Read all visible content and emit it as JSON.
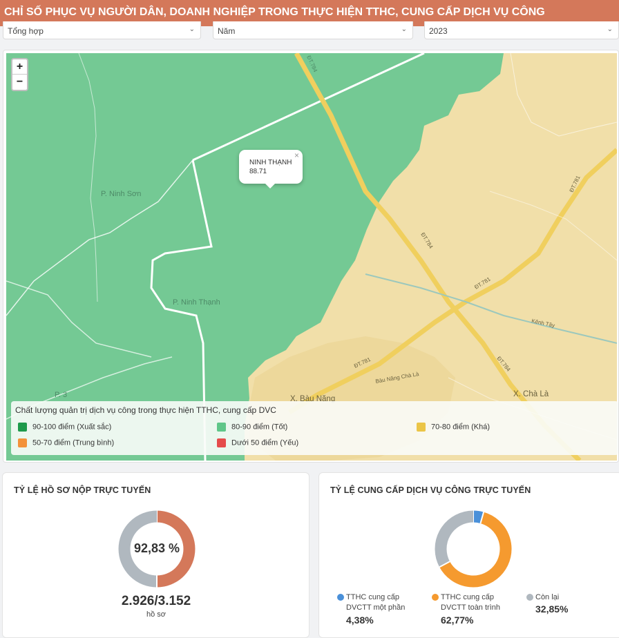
{
  "header": {
    "title": "CHỈ SỐ PHỤC VỤ NGƯỜI DÂN, DOANH NGHIỆP TRONG THỰC HIỆN TTHC, CUNG CẤP DỊCH VỤ CÔNG"
  },
  "filters": [
    {
      "value": "Tổng hợp"
    },
    {
      "value": "Năm"
    },
    {
      "value": "2023"
    }
  ],
  "map": {
    "zoom_in": "+",
    "zoom_out": "−",
    "popup": {
      "name": "NINH THẠNH",
      "score": "88.71",
      "close": "×"
    },
    "labels": {
      "ninh_son": "P. Ninh Sơn",
      "ninh_thanh": "P. Ninh Thạnh",
      "bau_nang": "X. Bàu Năng",
      "cha_la": "X. Chà Là",
      "p3": "P. 3",
      "dt784a": "ĐT.784",
      "dt784b": "ĐT.784",
      "dt784c": "ĐT.784",
      "dt781a": "ĐT.781",
      "dt781b": "ĐT.781",
      "dt781c": "ĐT.781",
      "kenh_tay": "Kênh Tây",
      "bau_nang_cha_la": "Bàu Năng Chà Là"
    },
    "colors": {
      "good": "#74c994",
      "fair": "#f1dfa9",
      "road": "#f0cf5e"
    }
  },
  "legend": {
    "title": "Chất lượng quản trị dịch vụ công trong thực hiện TTHC, cung cấp DVC",
    "items": [
      {
        "label": "90-100 điểm (Xuất sắc)",
        "color": "#1e9a4b"
      },
      {
        "label": "80-90 điểm (Tốt)",
        "color": "#5fc689"
      },
      {
        "label": "70-80 điểm (Khá)",
        "color": "#ebc547"
      },
      {
        "label": "50-70 điểm (Trung bình)",
        "color": "#f3923a"
      },
      {
        "label": "Dưới 50 điểm (Yếu)",
        "color": "#e54b4b"
      }
    ]
  },
  "card1": {
    "title": "TỶ LỆ HỒ SƠ NỘP TRỰC TUYẾN",
    "center": "92,83 %",
    "count": "2.926/3.152",
    "unit": "hồ sơ",
    "chart_data": {
      "type": "pie",
      "series": [
        {
          "values": [
            50,
            50
          ]
        }
      ],
      "colors": [
        "#d4785a",
        "#b0b8bf"
      ]
    }
  },
  "card2": {
    "title": "TỶ LỆ CUNG CẤP DỊCH VỤ CÔNG TRỰC TUYẾN",
    "chart_data": {
      "type": "pie",
      "categories": [
        "TTHC cung cấp DVCTT một phần",
        "TTHC cung cấp DVCTT toàn trình",
        "Còn lại"
      ],
      "values": [
        4.38,
        62.77,
        32.85
      ],
      "colors": [
        "#4a90d9",
        "#f59a2f",
        "#b0b8bf"
      ]
    },
    "legend": [
      {
        "line1": "TTHC cung cấp",
        "line2": "DVCTT một phần",
        "value": "4,38%"
      },
      {
        "line1": "TTHC cung cấp",
        "line2": "DVCTT toàn trình",
        "value": "62,77%"
      },
      {
        "line1": "Còn lại",
        "line2": "",
        "value": "32,85%"
      }
    ]
  }
}
